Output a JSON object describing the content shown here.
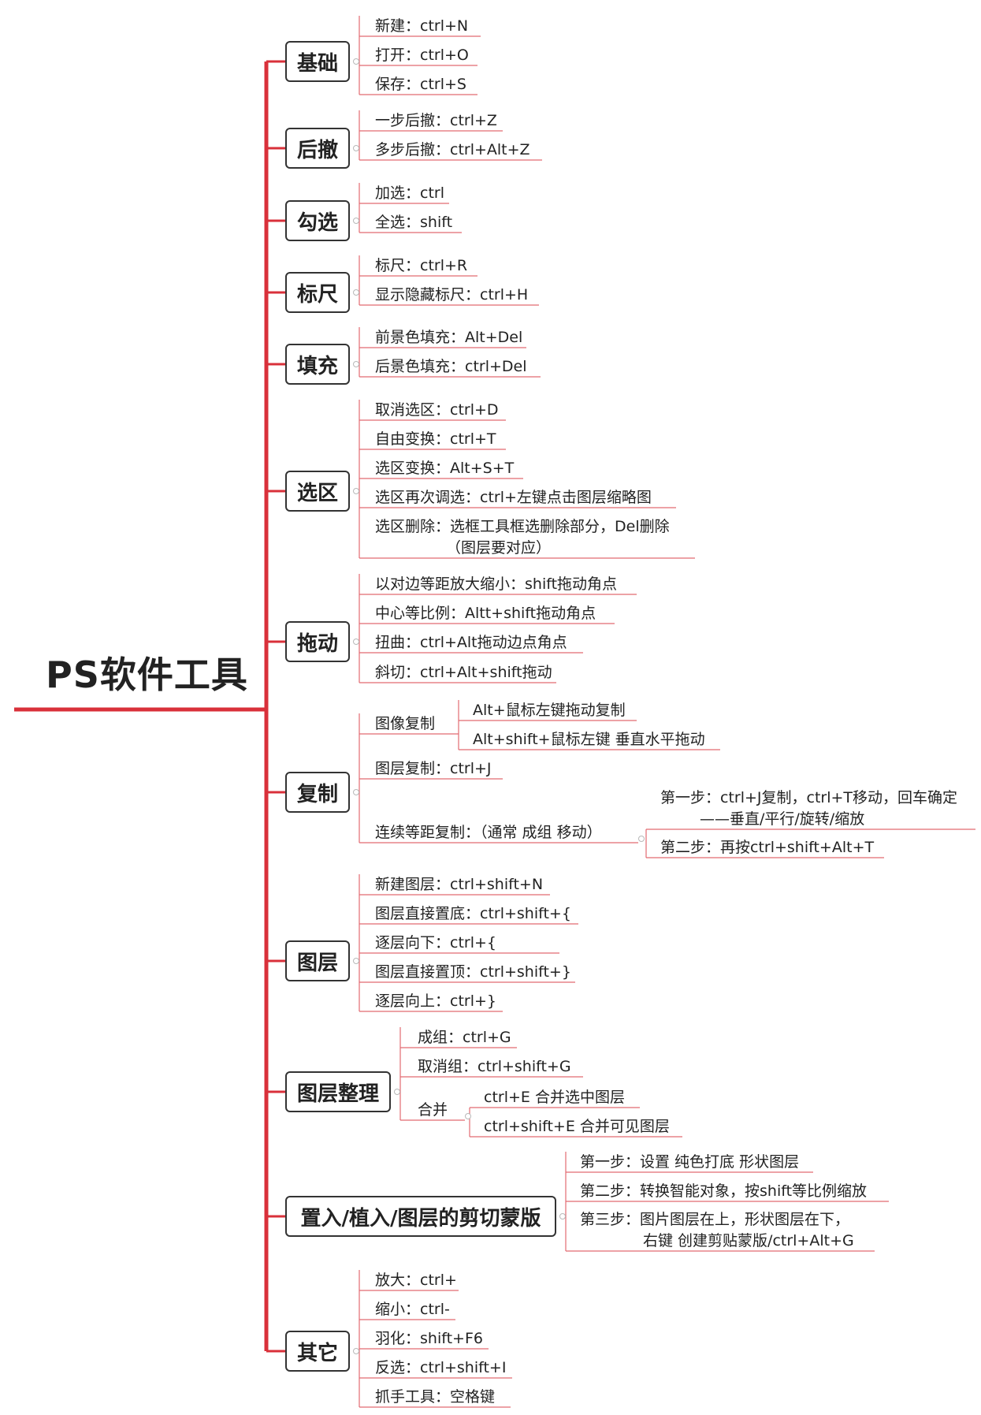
{
  "colors": {
    "spine": "#d9303a",
    "underline": "#e26a72",
    "box_border": "#333333"
  },
  "root": {
    "title": "PS软件工具"
  },
  "categories": [
    {
      "label": "基础",
      "items": [
        {
          "text": "新建：ctrl+N"
        },
        {
          "text": "打开：ctrl+O"
        },
        {
          "text": "保存：ctrl+S"
        }
      ]
    },
    {
      "label": "后撤",
      "items": [
        {
          "text": "一步后撤：ctrl+Z"
        },
        {
          "text": "多步后撤：ctrl+Alt+Z"
        }
      ]
    },
    {
      "label": "勾选",
      "items": [
        {
          "text": "加选：ctrl"
        },
        {
          "text": "全选：shift"
        }
      ]
    },
    {
      "label": "标尺",
      "items": [
        {
          "text": "标尺：ctrl+R"
        },
        {
          "text": "显示隐藏标尺：ctrl+H"
        }
      ]
    },
    {
      "label": "填充",
      "items": [
        {
          "text": "前景色填充：Alt+Del"
        },
        {
          "text": "后景色填充：ctrl+Del"
        }
      ]
    },
    {
      "label": "选区",
      "items": [
        {
          "text": "取消选区：ctrl+D"
        },
        {
          "text": "自由变换：ctrl+T"
        },
        {
          "text": "选区变换：Alt+S+T"
        },
        {
          "text": "选区再次调选：ctrl+左键点击图层缩略图"
        },
        {
          "text": "选区删除：选框工具框选删除部分，Del删除",
          "text2": "（图层要对应）"
        }
      ]
    },
    {
      "label": "拖动",
      "items": [
        {
          "text": "以对边等距放大缩小：shift拖动角点"
        },
        {
          "text": "中心等比例：Altt+shift拖动角点"
        },
        {
          "text": "扭曲：ctrl+Alt拖动边点角点"
        },
        {
          "text": "斜切：ctrl+Alt+shift拖动"
        }
      ]
    },
    {
      "label": "复制",
      "items": [
        {
          "text": "图像复制",
          "children": [
            {
              "text": "Alt+鼠标左键拖动复制"
            },
            {
              "text": "Alt+shift+鼠标左键 垂直水平拖动"
            }
          ]
        },
        {
          "text": "图层复制：ctrl+J"
        },
        {
          "text": "连续等距复制：（通常 成组 移动）",
          "children": [
            {
              "text": "第一步：ctrl+J复制，ctrl+T移动，回车确定",
              "text2": "——垂直/平行/旋转/缩放"
            },
            {
              "text": "第二步：再按ctrl+shift+Alt+T"
            }
          ]
        }
      ]
    },
    {
      "label": "图层",
      "items": [
        {
          "text": "新建图层：ctrl+shift+N"
        },
        {
          "text": "图层直接置底：ctrl+shift+{"
        },
        {
          "text": "逐层向下：ctrl+{"
        },
        {
          "text": "图层直接置顶：ctrl+shift+}"
        },
        {
          "text": "逐层向上：ctrl+}"
        }
      ]
    },
    {
      "label": "图层整理",
      "items": [
        {
          "text": "成组：ctrl+G"
        },
        {
          "text": "取消组：ctrl+shift+G"
        },
        {
          "text": "合并",
          "children": [
            {
              "text": "ctrl+E  合并选中图层"
            },
            {
              "text": "ctrl+shift+E 合并可见图层"
            }
          ]
        }
      ]
    },
    {
      "label": "置入/植入/图层的剪切蒙版",
      "items": [
        {
          "text": "第一步：设置 纯色打底 形状图层"
        },
        {
          "text": "第二步：转换智能对象，按shift等比例缩放"
        },
        {
          "text": "第三步：图片图层在上，形状图层在下，",
          "text2": "右键 创建剪贴蒙版/ctrl+Alt+G"
        }
      ]
    },
    {
      "label": "其它",
      "items": [
        {
          "text": "放大：ctrl+"
        },
        {
          "text": "缩小：ctrl-"
        },
        {
          "text": "羽化：shift+F6"
        },
        {
          "text": "反选：ctrl+shift+I"
        },
        {
          "text": "抓手工具：空格键"
        }
      ]
    }
  ]
}
